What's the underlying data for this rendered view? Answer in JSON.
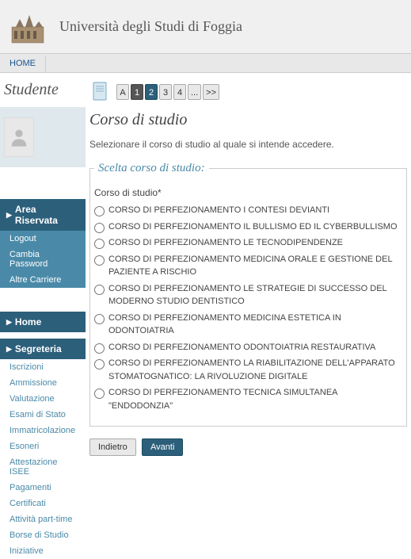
{
  "header": {
    "uni_name": "Università degli Studi di Foggia"
  },
  "nav": {
    "home": "HOME"
  },
  "sidebar": {
    "title": "Studente",
    "area_riservata": "Area Riservata",
    "logout": "Logout",
    "cambia_password": "Cambia Password",
    "altre_carriere": "Altre Carriere",
    "home": "Home",
    "segreteria": "Segreteria",
    "links": [
      "Iscrizioni",
      "Ammissione",
      "Valutazione",
      "Esami di Stato",
      "Immatricolazione",
      "Esoneri",
      "Attestazione ISEE",
      "Pagamenti",
      "Certificati",
      "Attività part-time",
      "Borse di Studio",
      "Iniziative"
    ]
  },
  "pagination": {
    "pages": [
      "A",
      "1",
      "2",
      "3",
      "4",
      "...",
      ">>"
    ]
  },
  "content": {
    "title": "Corso di studio",
    "desc": "Selezionare il corso di studio al quale si intende accedere.",
    "legend": "Scelta corso di studio:",
    "field_label": "Corso di studio*",
    "options": [
      "CORSO DI PERFEZIONAMENTO I CONTESI DEVIANTI",
      "CORSO DI PERFEZIONAMENTO IL BULLISMO ED IL CYBERBULLISMO",
      "CORSO DI PERFEZIONAMENTO LE TECNODIPENDENZE",
      "CORSO DI PERFEZIONAMENTO  MEDICINA ORALE E GESTIONE DEL PAZIENTE A RISCHIO",
      "CORSO DI PERFEZIONAMENTO LE STRATEGIE DI SUCCESSO DEL MODERNO STUDIO DENTISTICO",
      "CORSO DI PERFEZIONAMENTO  MEDICINA ESTETICA IN ODONTOIATRIA",
      "CORSO DI PERFEZIONAMENTO  ODONTOIATRIA RESTAURATIVA",
      "CORSO DI PERFEZIONAMENTO  LA RIABILITAZIONE DELL'APPARATO STOMATOGNATICO: LA RIVOLUZIONE DIGITALE",
      "CORSO DI PERFEZIONAMENTO TECNICA SIMULTANEA  \"ENDODONZIA\""
    ],
    "btn_back": "Indietro",
    "btn_forward": "Avanti"
  }
}
